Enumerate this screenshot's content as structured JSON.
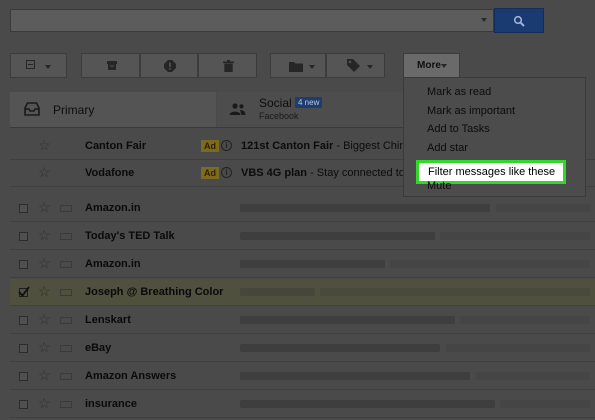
{
  "search": {
    "value": "",
    "placeholder": ""
  },
  "toolbar": {
    "more_label": "More"
  },
  "tabs": {
    "primary": {
      "label": "Primary"
    },
    "social": {
      "label": "Social",
      "badge": "4 new",
      "subtitle": "Facebook"
    }
  },
  "ads": [
    {
      "sender": "Canton Fair",
      "badge": "Ad",
      "subject": "121st Canton Fair",
      "snippet": " - Biggest China"
    },
    {
      "sender": "Vodafone",
      "badge": "Ad",
      "subject": "VBS 4G plan",
      "snippet": " - Stay connected to"
    }
  ],
  "emails": [
    {
      "sender": "Amazon.in",
      "checked": false
    },
    {
      "sender": "Today's TED Talk",
      "checked": false
    },
    {
      "sender": "Amazon.in",
      "checked": false
    },
    {
      "sender": "Joseph @ Breathing Color",
      "checked": true
    },
    {
      "sender": "Lenskart",
      "checked": false
    },
    {
      "sender": "eBay",
      "checked": false
    },
    {
      "sender": "Amazon Answers",
      "checked": false
    },
    {
      "sender": "insurance",
      "checked": false
    }
  ],
  "more_menu": {
    "items": [
      {
        "label": "Mark as read"
      },
      {
        "label": "Mark as important"
      },
      {
        "label": "Add to Tasks"
      },
      {
        "label": "Add star"
      },
      {
        "label": "Filter messages like these",
        "highlighted": true
      },
      {
        "label": "Mute"
      }
    ]
  },
  "colors": {
    "highlight_border": "#33d62a",
    "search_button": "#1a3a72"
  }
}
